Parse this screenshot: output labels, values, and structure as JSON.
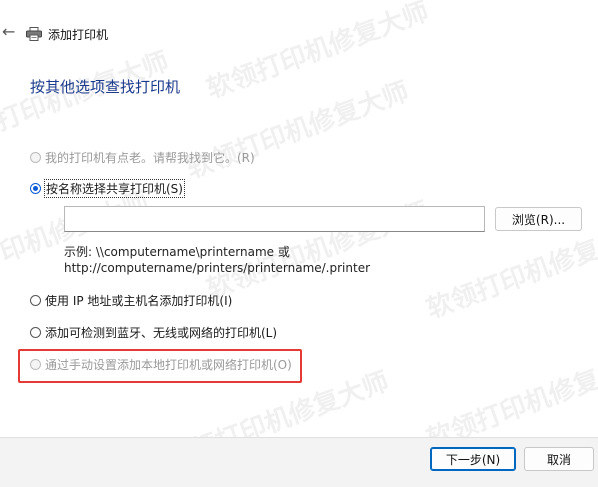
{
  "watermark": "软领打印机修复大师",
  "window": {
    "title": "添加打印机"
  },
  "heading": "按其他选项查找打印机",
  "options": [
    {
      "label": "我的打印机有点老。请帮我找到它。(R)",
      "checked": false,
      "disabled": true
    },
    {
      "label": "按名称选择共享打印机(S)",
      "checked": true,
      "disabled": false
    },
    {
      "label": "使用 IP 地址或主机名添加打印机(I)",
      "checked": false,
      "disabled": false
    },
    {
      "label": "添加可检测到蓝牙、无线或网络的打印机(L)",
      "checked": false,
      "disabled": false
    },
    {
      "label": "通过手动设置添加本地打印机或网络打印机(O)",
      "checked": false,
      "disabled": true
    }
  ],
  "share_input": {
    "value": "",
    "placeholder": ""
  },
  "browse_button": "浏览(R)...",
  "example": {
    "line1": "示例: \\\\computername\\printername 或",
    "line2": "http://computername/printers/printername/.printer"
  },
  "buttons": {
    "next": "下一步(N)",
    "cancel": "取消"
  },
  "colors": {
    "heading": "#1c3a8c",
    "accent": "#0a5bd6",
    "highlight_box": "#e53935"
  }
}
